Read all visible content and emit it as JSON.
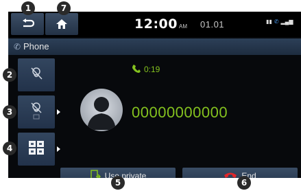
{
  "top_bar": {
    "clock": "12:00",
    "ampm": "AM",
    "date": "01.01",
    "icons": [
      "back-icon",
      "home-icon"
    ]
  },
  "title_bar": {
    "title": "Phone",
    "icon": "phone-icon"
  },
  "side_buttons": [
    {
      "icon": "mute-microphone-icon"
    },
    {
      "icon": "microphone-volume-icon",
      "has_submenu": true
    },
    {
      "icon": "keypad-icon",
      "has_submenu": true
    }
  ],
  "call": {
    "duration": "0:19",
    "number": "00000000000"
  },
  "bottom_buttons": {
    "use_private_label": "Use private",
    "end_label": "End"
  },
  "callouts": [
    "1",
    "2",
    "3",
    "4",
    "5",
    "6",
    "7"
  ],
  "colors": {
    "accent_green": "#84c21f",
    "end_red": "#e0262a",
    "button_blue": "#2c3f57"
  }
}
